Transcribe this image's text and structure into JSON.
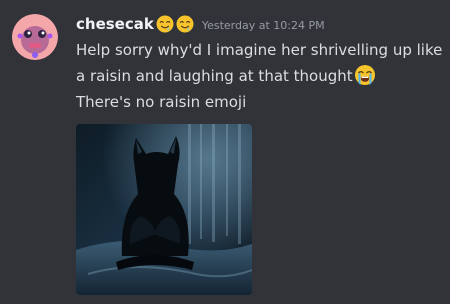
{
  "message": {
    "author": "chesecak",
    "author_emojis": [
      "relieved-drooling-face-icon",
      "relieved-drooling-face-icon"
    ],
    "timestamp": "Yesterday at 10:24 PM",
    "line1": "Help sorry why'd I imagine her shrivelling up like a raisin and laughing at that thought",
    "line1_emoji": "loudly-crying-face-icon",
    "line2": "There's no raisin emoji"
  },
  "attachment": {
    "type": "image",
    "subject": "cat-covering-face-image"
  },
  "colors": {
    "background": "#313338",
    "username": "#f2f3f5",
    "text": "#dbdee1",
    "timestamp": "#949ba4"
  }
}
